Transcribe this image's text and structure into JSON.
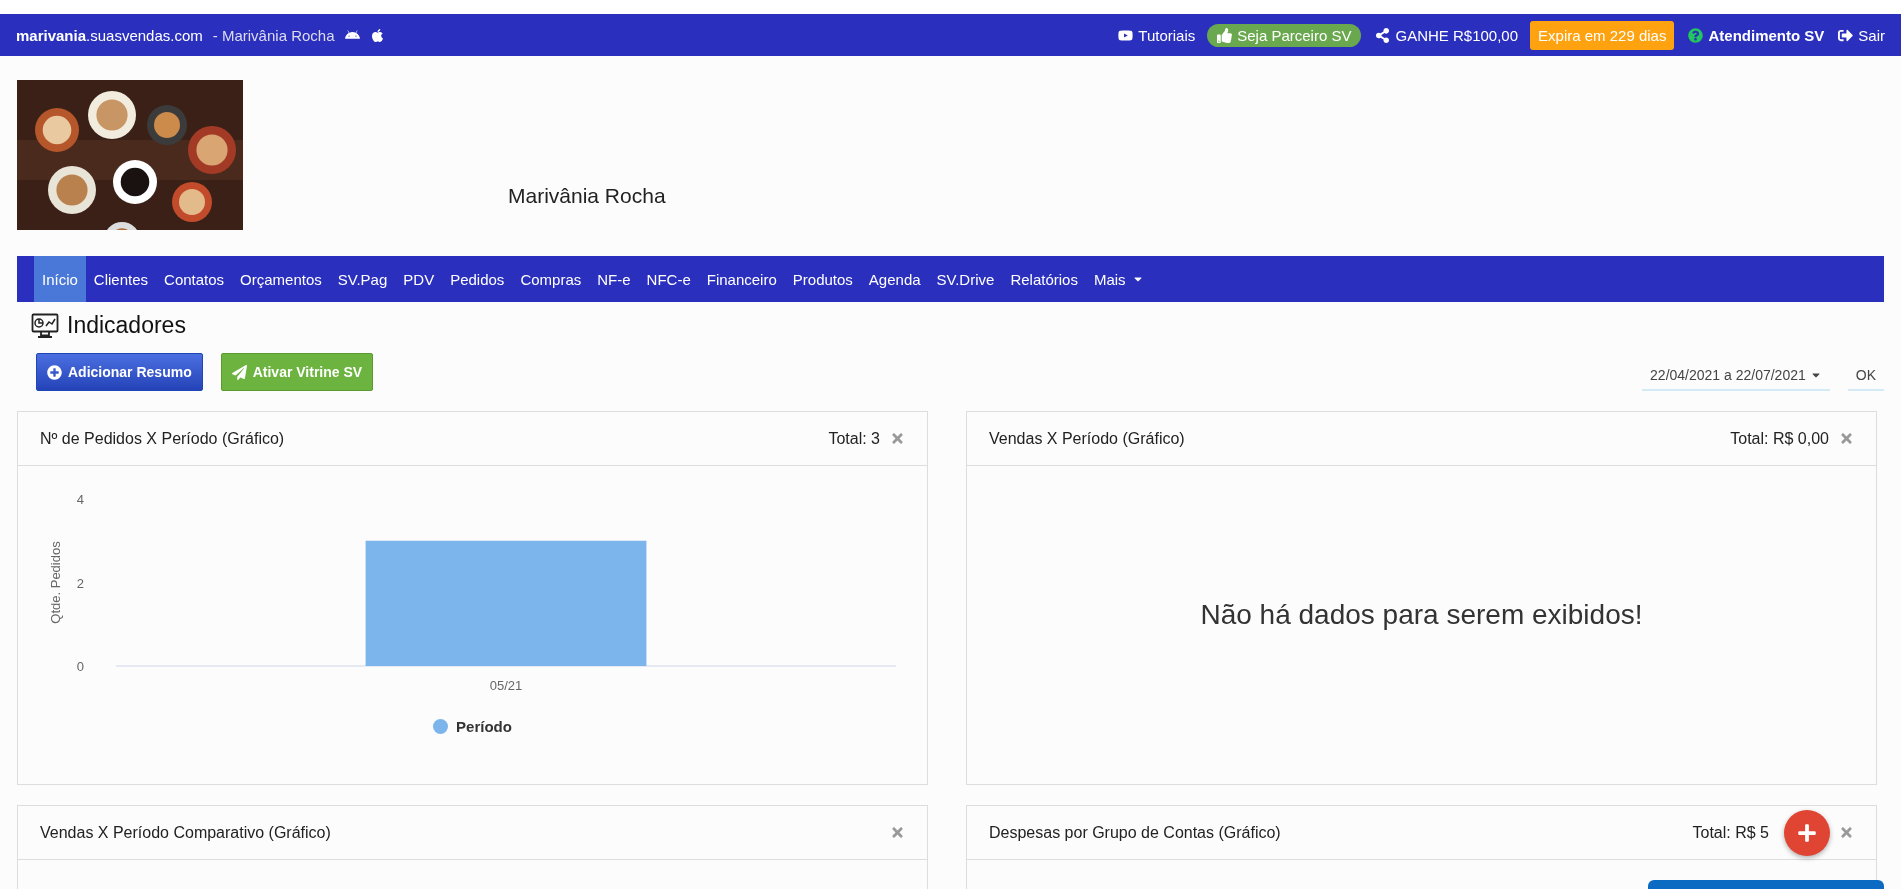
{
  "top_bar": {
    "site": "**marivania**.suasvendas.com",
    "owner": "- Marivânia Rocha",
    "links": [
      {
        "kind": "video",
        "label": "Tutoriais"
      },
      {
        "kind": "pill",
        "label": "Seja Parceiro SV"
      },
      {
        "kind": "share",
        "label": "GANHE R$100,00"
      },
      {
        "kind": "badge",
        "label": "Expira em 229 dias"
      },
      {
        "kind": "help",
        "label": "Atendimento SV"
      },
      {
        "kind": "exit",
        "label": "Sair"
      }
    ]
  },
  "header": {
    "company": "Marivânia Rocha"
  },
  "nav": [
    {
      "label": "Início",
      "selected": true
    },
    {
      "label": "Clientes",
      "selected": false
    },
    {
      "label": "Contatos",
      "selected": false
    },
    {
      "label": "Orçamentos",
      "selected": false
    },
    {
      "label": "SV.Pag",
      "selected": false
    },
    {
      "label": "PDV",
      "selected": false
    },
    {
      "label": "Pedidos",
      "selected": false
    },
    {
      "label": "Compras",
      "selected": false
    },
    {
      "label": "NF-e",
      "selected": false
    },
    {
      "label": "NFC-e",
      "selected": false
    },
    {
      "label": "Financeiro",
      "selected": false
    },
    {
      "label": "Produtos",
      "selected": false
    },
    {
      "label": "Agenda",
      "selected": false
    },
    {
      "label": "SV.Drive",
      "selected": false
    },
    {
      "label": "Relatórios",
      "selected": false
    },
    {
      "label": "Mais",
      "selected": false,
      "dropdown": true
    }
  ],
  "page_title": "Indicadores",
  "actions": [
    {
      "kind": "add",
      "label": "Adicionar Resumo"
    },
    {
      "kind": "send",
      "label": "Ativar Vitrine SV"
    }
  ],
  "date_range": {
    "value": "22/04/2021 a 22/07/2021",
    "button": "OK"
  },
  "panels": [
    {
      "title": "Nº de Pedidos X Período (Gráfico)",
      "total": "Total: 3",
      "chart_data": {
        "type": "bar",
        "ylabel": "Qtde. Pedidos",
        "categories": [
          "05/21"
        ],
        "series": [
          {
            "name": "Período",
            "color": "#7cb5ec",
            "values": [
              3
            ]
          }
        ],
        "ylim": [
          0,
          4
        ],
        "yticks": [
          0,
          2,
          4
        ]
      }
    },
    {
      "title": "Vendas X Período (Gráfico)",
      "total": "Total: R$ 0,00",
      "message": "Não há dados para serem exibidos!"
    },
    {
      "title": "Vendas X Período Comparativo (Gráfico)"
    },
    {
      "title": "Despesas por Grupo de Contas (Gráfico)",
      "total": "Total: R$ 5"
    }
  ]
}
